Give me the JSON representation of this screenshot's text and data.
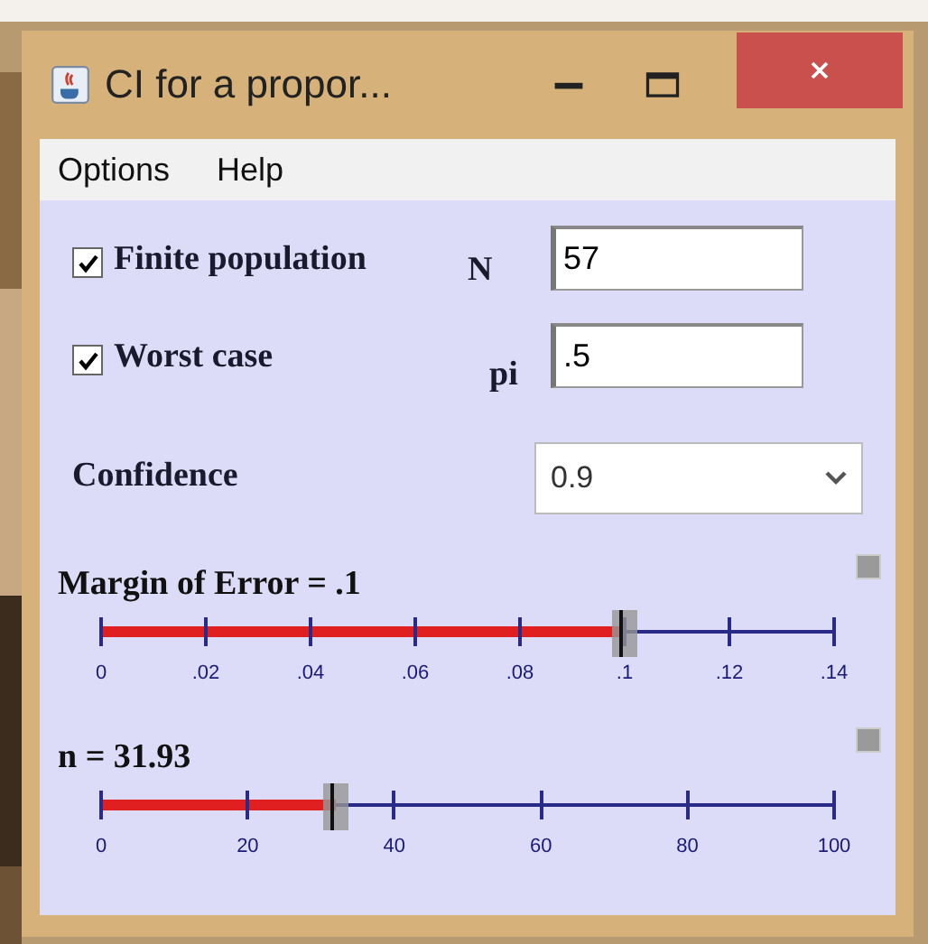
{
  "window": {
    "title": "CI for a propor..."
  },
  "menu": [
    "Options",
    "Help"
  ],
  "options": [
    {
      "label": "Finite population",
      "checked": true,
      "field_label": "N",
      "value": "57"
    },
    {
      "label": "Worst case",
      "checked": true,
      "field_label": "pi",
      "value": ".5"
    }
  ],
  "confidence": {
    "label": "Confidence",
    "value": "0.9"
  },
  "sliders": [
    {
      "label": "Margin of Error = .1",
      "level": 0.714,
      "ticks": [
        "0",
        ".02",
        ".04",
        ".06",
        ".08",
        ".1",
        ".12",
        ".14"
      ]
    },
    {
      "label": "n = 31.93",
      "level": 0.319,
      "ticks": [
        "0",
        "20",
        "40",
        "60",
        "80",
        "100"
      ]
    }
  ]
}
